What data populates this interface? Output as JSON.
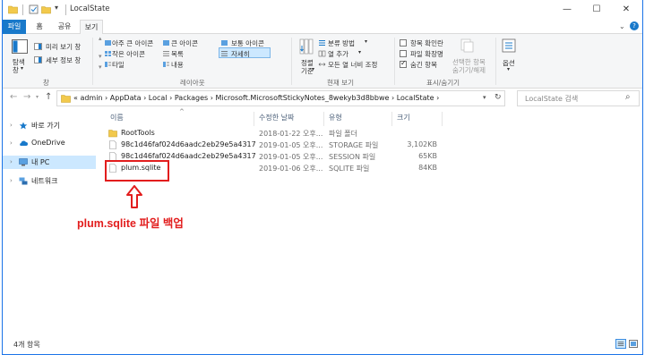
{
  "window": {
    "title": "LocalState"
  },
  "titlebar": {
    "minimize_icon": "minimize-icon",
    "maximize_icon": "maximize-icon",
    "close_icon": "close-icon"
  },
  "ribbon_tabs": [
    "파일",
    "홈",
    "공유",
    "보기"
  ],
  "ribbon": {
    "panes": {
      "nav_pane_label_line1": "탐색",
      "nav_pane_label_line2": "창",
      "preview_pane": "미리 보기 창",
      "details_pane": "세부 정보 창",
      "group_label": "창"
    },
    "layout": {
      "items": [
        "아주 큰 아이콘",
        "큰 아이콘",
        "보통 아이콘",
        "작은 아이콘",
        "목록",
        "자세히",
        "타일",
        "내용"
      ],
      "group_label": "레이아웃"
    },
    "current_view": {
      "sort_label_line1": "정렬",
      "sort_label_line2": "기준",
      "group_by": "분류 방법",
      "add_columns": "열 추가",
      "size_all_columns": "모든 열 너비 조정",
      "group_label": "현재 보기"
    },
    "show_hide": {
      "item_checkboxes": "항목 확인란",
      "file_extensions": "파일 확장명",
      "hidden_items": "숨긴 항목",
      "hide_selected_line1": "선택한 항목",
      "hide_selected_line2": "숨기기/해제",
      "options": "옵션",
      "group_label": "표시/숨기기"
    }
  },
  "address": {
    "path": "«  admin  ›  AppData  ›  Local  ›  Packages  ›  Microsoft.MicrosoftStickyNotes_8wekyb3d8bbwe  ›  LocalState  ›",
    "search_placeholder": "LocalState 검색"
  },
  "nav_pane": {
    "items": [
      "바로 가기",
      "OneDrive",
      "내 PC",
      "네트워크"
    ]
  },
  "file_list": {
    "columns": [
      "이름",
      "수정한 날짜",
      "유형",
      "크기"
    ],
    "rows": [
      {
        "name": "RootTools",
        "date": "2018-01-22 오후...",
        "type": "파일 폴더",
        "size": ""
      },
      {
        "name": "98c1d46faf024d6aadc2eb29e5a4317c.s...",
        "date": "2019-01-05 오후...",
        "type": "STORAGE 파일",
        "size": "3,102KB"
      },
      {
        "name": "98c1d46faf024d6aadc2eb29e5a4317c.s...",
        "date": "2019-01-05 오후...",
        "type": "SESSION 파일",
        "size": "65KB"
      },
      {
        "name": "plum.sqlite",
        "date": "2019-01-06 오후...",
        "type": "SQLITE 파일",
        "size": "84KB"
      }
    ]
  },
  "annotation": {
    "text": "plum.sqlite 파일 백업",
    "color": "#e21d1d"
  },
  "status": {
    "item_count": "4개 항목"
  },
  "colors": {
    "accent": "#1979ca",
    "selection": "#cce8ff",
    "folder": "#f2c94c"
  }
}
